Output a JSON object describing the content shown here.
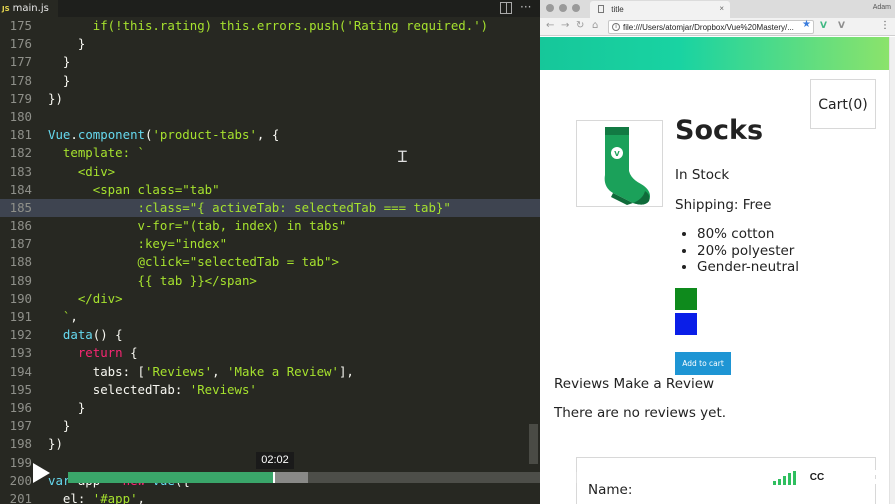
{
  "editor": {
    "tab": {
      "icon_label": "JS",
      "filename": "main.js"
    },
    "lines": [
      {
        "n": "175",
        "tokens": [
          {
            "c": "s",
            "t": "      if(!this.rating) this.errors.push('Rating required.')"
          }
        ]
      },
      {
        "n": "176",
        "tokens": [
          {
            "c": "p",
            "t": "    }"
          }
        ]
      },
      {
        "n": "177",
        "tokens": [
          {
            "c": "p",
            "t": "  }"
          }
        ]
      },
      {
        "n": "178",
        "tokens": [
          {
            "c": "p",
            "t": "  }"
          }
        ]
      },
      {
        "n": "179",
        "tokens": [
          {
            "c": "p",
            "t": "})"
          }
        ]
      },
      {
        "n": "180",
        "tokens": []
      },
      {
        "n": "181",
        "tokens": [
          {
            "c": "k",
            "t": "Vue"
          },
          {
            "c": "p",
            "t": "."
          },
          {
            "c": "k",
            "t": "component"
          },
          {
            "c": "p",
            "t": "("
          },
          {
            "c": "s",
            "t": "'product-tabs'"
          },
          {
            "c": "p",
            "t": ", {"
          }
        ]
      },
      {
        "n": "182",
        "tokens": [
          {
            "c": "g",
            "t": "  template: `"
          }
        ]
      },
      {
        "n": "183",
        "tokens": [
          {
            "c": "g",
            "t": "    <div>"
          }
        ]
      },
      {
        "n": "184",
        "tokens": [
          {
            "c": "g",
            "t": "      <span class=\"tab\""
          }
        ]
      },
      {
        "n": "185",
        "tokens": [
          {
            "c": "g",
            "t": "            :class=\"{ activeTab: selectedTab === tab}\""
          }
        ],
        "highlight": true
      },
      {
        "n": "186",
        "tokens": [
          {
            "c": "g",
            "t": "            v-for=\"(tab, index) in tabs\""
          }
        ]
      },
      {
        "n": "187",
        "tokens": [
          {
            "c": "g",
            "t": "            :key=\"index\""
          }
        ]
      },
      {
        "n": "188",
        "tokens": [
          {
            "c": "g",
            "t": "            @click=\"selectedTab = tab\">"
          }
        ]
      },
      {
        "n": "189",
        "tokens": [
          {
            "c": "g",
            "t": "            {{ tab }}</span>"
          }
        ]
      },
      {
        "n": "190",
        "tokens": [
          {
            "c": "g",
            "t": "    </div>"
          }
        ]
      },
      {
        "n": "191",
        "tokens": [
          {
            "c": "g",
            "t": "  `"
          },
          {
            "c": "p",
            "t": ","
          }
        ]
      },
      {
        "n": "192",
        "tokens": [
          {
            "c": "k",
            "t": "  data"
          },
          {
            "c": "p",
            "t": "() {"
          }
        ]
      },
      {
        "n": "193",
        "tokens": [
          {
            "c": "kw",
            "t": "    return"
          },
          {
            "c": "p",
            "t": " {"
          }
        ]
      },
      {
        "n": "194",
        "tokens": [
          {
            "c": "p",
            "t": "      tabs: ["
          },
          {
            "c": "s",
            "t": "'Reviews'"
          },
          {
            "c": "p",
            "t": ", "
          },
          {
            "c": "s",
            "t": "'Make a Review'"
          },
          {
            "c": "p",
            "t": "],"
          }
        ]
      },
      {
        "n": "195",
        "tokens": [
          {
            "c": "p",
            "t": "      selectedTab: "
          },
          {
            "c": "s",
            "t": "'Reviews'"
          }
        ]
      },
      {
        "n": "196",
        "tokens": [
          {
            "c": "p",
            "t": "    }"
          }
        ]
      },
      {
        "n": "197",
        "tokens": [
          {
            "c": "p",
            "t": "  }"
          }
        ]
      },
      {
        "n": "198",
        "tokens": [
          {
            "c": "p",
            "t": "})"
          }
        ]
      },
      {
        "n": "199",
        "tokens": []
      },
      {
        "n": "200",
        "tokens": [
          {
            "c": "k",
            "t": "var"
          },
          {
            "c": "p",
            "t": " app = "
          },
          {
            "c": "kw",
            "t": "new"
          },
          {
            "c": "p",
            "t": " "
          },
          {
            "c": "k",
            "t": "Vue"
          },
          {
            "c": "p",
            "t": "({"
          }
        ]
      },
      {
        "n": "201",
        "tokens": [
          {
            "c": "p",
            "t": "  el: "
          },
          {
            "c": "s",
            "t": "'#app'"
          },
          {
            "c": "p",
            "t": ","
          }
        ]
      }
    ]
  },
  "browser": {
    "tab_title": "title",
    "tab_close": "×",
    "profile": "Adam",
    "url": "file:///Users/atomjar/Dropbox/Vue%20Mastery/...",
    "nav": {
      "back": "←",
      "forward": "→",
      "reload": "↻",
      "home": "⌂",
      "star": "★",
      "menu": "⋮"
    },
    "extensions": [
      {
        "label": "V",
        "color": "#41b883"
      },
      {
        "label": "V",
        "color": "#8e8e8e"
      }
    ],
    "page": {
      "cart_label": "Cart(0)",
      "product_title": "Socks",
      "stock_text": "In Stock",
      "shipping_text": "Shipping: Free",
      "details": [
        "80% cotton",
        "20% polyester",
        "Gender-neutral"
      ],
      "variants": [
        {
          "color": "#0e8a1c"
        },
        {
          "color": "#0a1ee8"
        }
      ],
      "add_to_cart_label": "Add to cart",
      "tabs": [
        "Reviews",
        "Make a Review"
      ],
      "no_reviews_text": "There are no reviews yet.",
      "form_name_label": "Name:",
      "sock_logo": "V"
    }
  },
  "player": {
    "timestamp": "02:02",
    "cc_label": "CC",
    "gear_icon": "⚙",
    "progress_played": 0.297,
    "progress_buffered": 0.346
  }
}
